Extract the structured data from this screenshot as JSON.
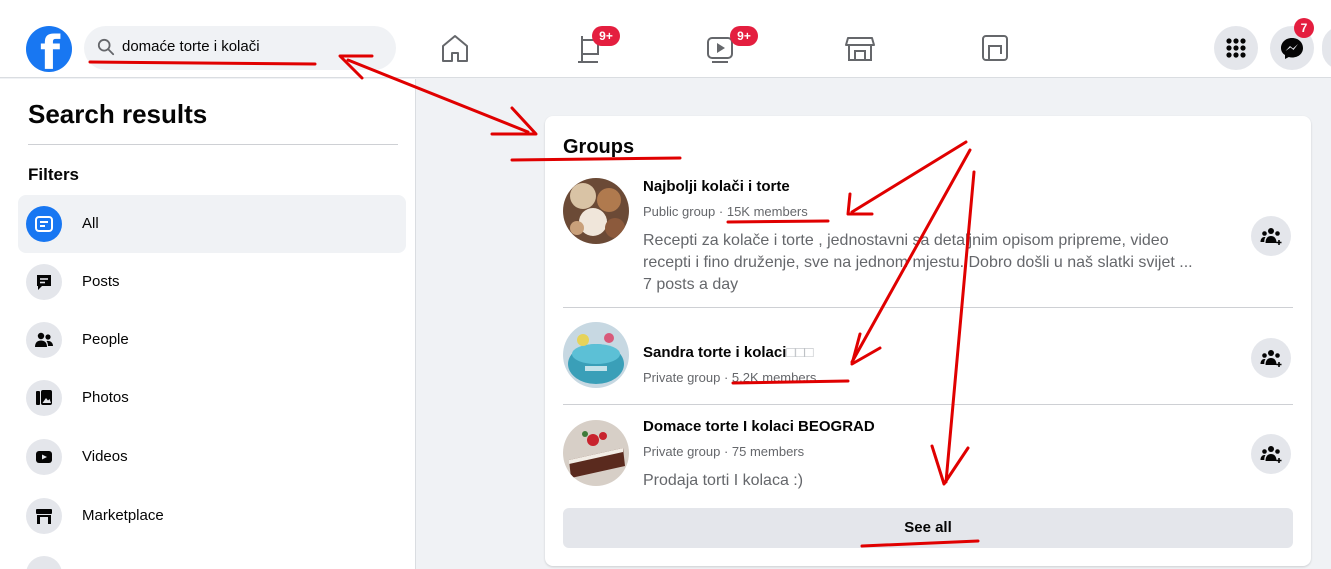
{
  "search": {
    "value": "domaće torte i kolači"
  },
  "nav": {
    "pages_badge": "9+",
    "watch_badge": "9+",
    "messenger_badge": "7"
  },
  "sidebar": {
    "title": "Search results",
    "filters_label": "Filters",
    "items": [
      {
        "label": "All",
        "icon": "search-results-icon",
        "active": true
      },
      {
        "label": "Posts",
        "icon": "posts-icon"
      },
      {
        "label": "People",
        "icon": "people-icon"
      },
      {
        "label": "Photos",
        "icon": "photos-icon"
      },
      {
        "label": "Videos",
        "icon": "videos-icon"
      },
      {
        "label": "Marketplace",
        "icon": "marketplace-icon"
      }
    ]
  },
  "groups": {
    "title": "Groups",
    "items": [
      {
        "name": "Najbolji kolači i torte",
        "privacy": "Public group",
        "members": "15K members",
        "description_line1": "Recepti za kolače i torte , jednostavni sa detaljnim opisom pripreme, video",
        "description_line2": "recepti i fino druženje, sve na jednom mjestu. Dobro došli u naš slatki svijet ...",
        "activity": "7 posts a day"
      },
      {
        "name": "Sandra torte i kolaci",
        "name_suffix": "□□□",
        "privacy": "Private group",
        "members": "5.2K members"
      },
      {
        "name": "Domace torte I kolaci BEOGRAD",
        "privacy": "Private group",
        "members": "75 members",
        "description_line1": "Prodaja torti I kolaca :)"
      }
    ],
    "see_all_label": "See all"
  },
  "colors": {
    "brand": "#1877f2",
    "badge": "#e41e3f",
    "annotation": "#e00000"
  }
}
